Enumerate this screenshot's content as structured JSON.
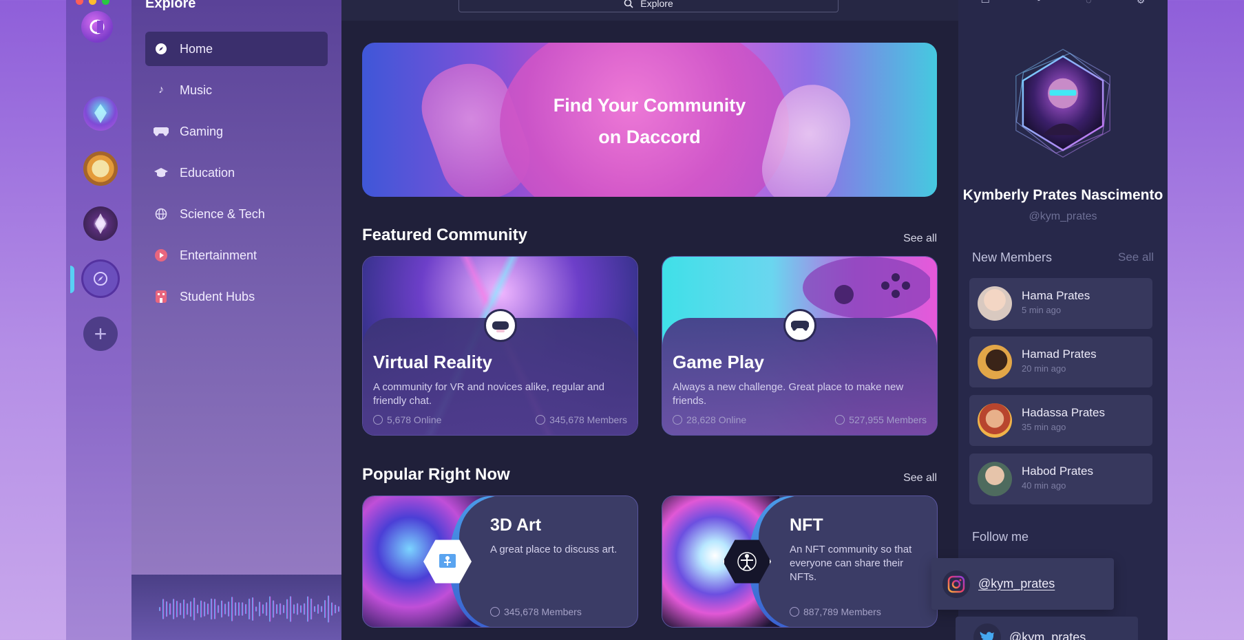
{
  "app": {
    "section_title": "Explore"
  },
  "window_controls": {
    "close_color": "#ff5f57",
    "min_color": "#febc2e",
    "max_color": "#28c840"
  },
  "servers": [
    {
      "name": "server-logo"
    },
    {
      "name": "crystal-server"
    },
    {
      "name": "ramen-server"
    },
    {
      "name": "gem-server"
    },
    {
      "name": "explore-server"
    },
    {
      "name": "add-server",
      "label": "+"
    }
  ],
  "nav": {
    "items": [
      {
        "label": "Home",
        "icon": "compass-icon"
      },
      {
        "label": "Music",
        "icon": "music-note-icon"
      },
      {
        "label": "Gaming",
        "icon": "gamepad-icon"
      },
      {
        "label": "Education",
        "icon": "graduation-cap-icon"
      },
      {
        "label": "Science & Tech",
        "icon": "globe-icon"
      },
      {
        "label": "Entertainment",
        "icon": "play-icon"
      },
      {
        "label": "Student Hubs",
        "icon": "building-icon"
      }
    ]
  },
  "search": {
    "label": "Explore"
  },
  "hero": {
    "line1": "Find Your Community",
    "line2": "on Daccord"
  },
  "featured": {
    "title": "Featured Community",
    "see_all": "See all",
    "cards": [
      {
        "title": "Virtual Reality",
        "desc": "A community for VR and novices alike, regular and friendly chat.",
        "online": "5,678 Online",
        "members": "345,678 Members"
      },
      {
        "title": "Game Play",
        "desc": "Always a new challenge. Great place to make new friends.",
        "online": "28,628 Online",
        "members": "527,955 Members"
      }
    ]
  },
  "popular": {
    "title": "Popular Right Now",
    "see_all": "See all",
    "cards": [
      {
        "title": "3D Art",
        "desc": "A great place to discuss art.",
        "members": "345,678 Members"
      },
      {
        "title": "NFT",
        "desc": "An NFT community so that everyone can share their NFTs.",
        "members": "887,789 Members"
      }
    ]
  },
  "profile": {
    "name": "Kymberly Prates Nascimento",
    "handle": "@kym_prates"
  },
  "new_members": {
    "title": "New Members",
    "see_all": "See all",
    "list": [
      {
        "name": "Hama Prates",
        "time": "5 min ago"
      },
      {
        "name": "Hamad Prates",
        "time": "20 min ago"
      },
      {
        "name": "Hadassa Prates",
        "time": "35 min ago"
      },
      {
        "name": "Habod Prates",
        "time": "40 min ago"
      }
    ]
  },
  "follow": {
    "title": "Follow me",
    "instagram": "@kym_prates",
    "twitter": "@kym_prates"
  }
}
